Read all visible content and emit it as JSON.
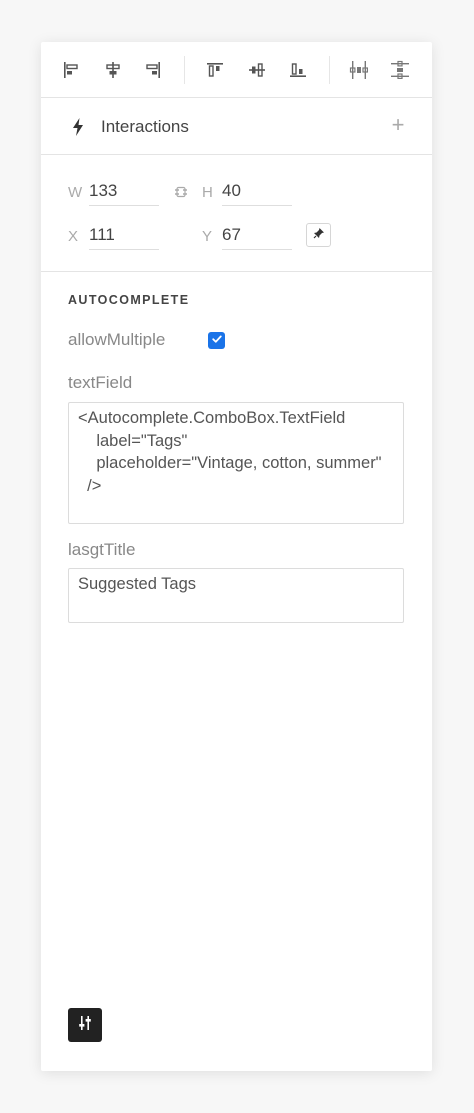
{
  "toolbar": {
    "icons": [
      "align-left-icon",
      "align-center-horizontal-icon",
      "align-right-icon",
      "align-top-icon",
      "align-middle-vertical-icon",
      "align-bottom-icon",
      "distribute-horizontal-icon",
      "distribute-vertical-icon"
    ]
  },
  "interactions": {
    "label": "Interactions",
    "add_symbol": "+"
  },
  "dimensions": {
    "w_label": "W",
    "w_value": "133",
    "h_label": "H",
    "h_value": "40",
    "x_label": "X",
    "x_value": "111",
    "y_label": "Y",
    "y_value": "67"
  },
  "section": {
    "title": "AUTOCOMPLETE"
  },
  "props": {
    "allow_multiple_label": "allowMultiple",
    "allow_multiple_checked": true,
    "text_field_label": "textField",
    "text_field_value": "<Autocomplete.ComboBox.TextField\n    label=\"Tags\"\n    placeholder=\"Vintage, cotton, summer\"\n  />",
    "list_title_label": "lasgtTitle",
    "list_title_value": "Suggested Tags"
  },
  "colors": {
    "accent": "#1a73e8",
    "footer_button": "#222222"
  }
}
